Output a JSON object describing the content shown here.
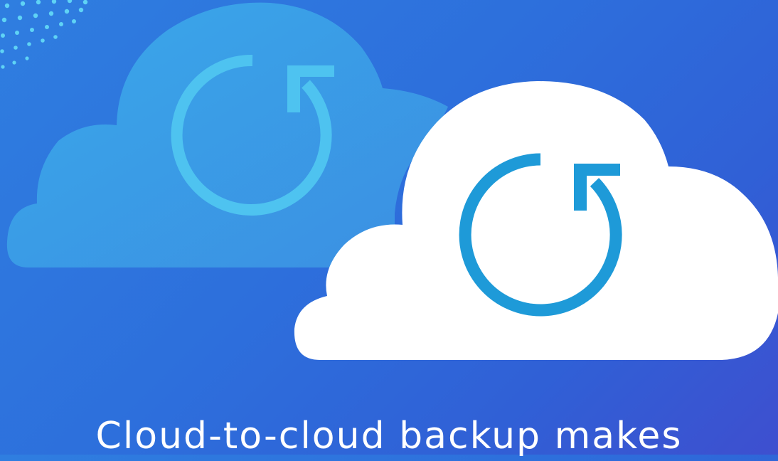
{
  "headline": "Cloud-to-cloud backup makes",
  "colors": {
    "background_start": "#2f7ee0",
    "background_end": "#3e4fcf",
    "back_cloud": "#3a9be6",
    "back_refresh": "#4ec3f0",
    "front_cloud": "#ffffff",
    "front_refresh": "#1e9ad8",
    "dots": "#5fd3f5"
  },
  "icons": {
    "back_cloud": "cloud-icon",
    "back_refresh": "refresh-icon",
    "front_cloud": "cloud-icon",
    "front_refresh": "refresh-icon",
    "decoration": "dot-pattern"
  }
}
